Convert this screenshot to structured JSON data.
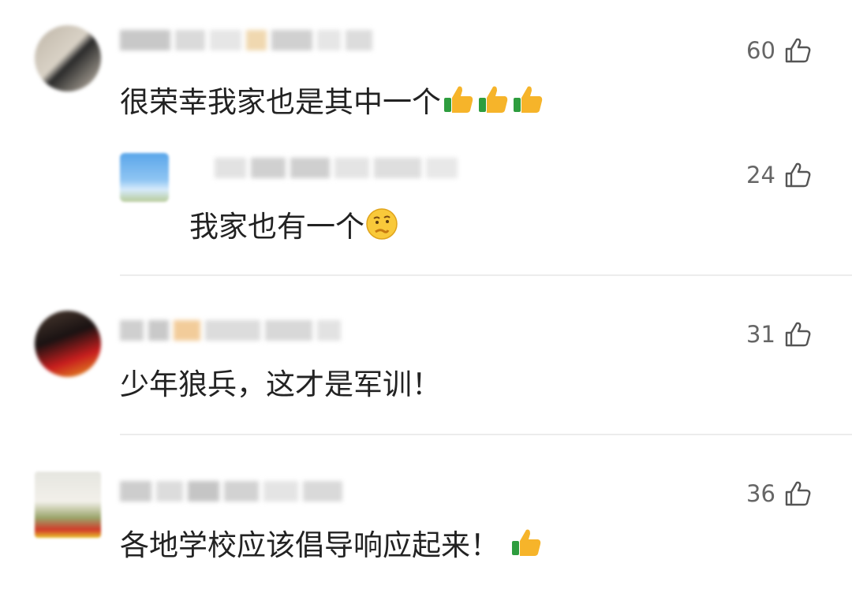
{
  "comments": [
    {
      "likes": "60",
      "text": "很荣幸我家也是其中一个",
      "emojis": [
        "thumbs-up-emoji",
        "thumbs-up-emoji",
        "thumbs-up-emoji"
      ]
    },
    {
      "likes": "24",
      "text": "我家也有一个",
      "emojis": [
        "thinking-face-emoji"
      ],
      "reply": true
    },
    {
      "likes": "31",
      "text": "少年狼兵，这才是军训！"
    },
    {
      "likes": "36",
      "text": "各地学校应该倡导响应起来！",
      "emojis": [
        "thumbs-up-emoji"
      ]
    }
  ],
  "icons": {
    "like": "thumb-up-outline-icon"
  },
  "colors": {
    "text": "#222222",
    "likes": "#666666",
    "divider": "#ececec"
  }
}
